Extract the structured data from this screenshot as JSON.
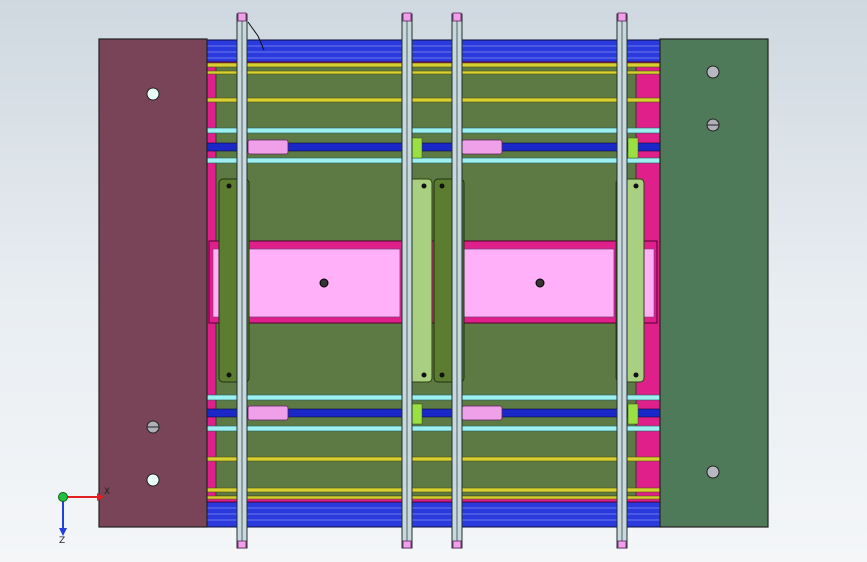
{
  "view": {
    "background_top": "#cfd8e0",
    "background_bottom": "#f4f6f8"
  },
  "triad": {
    "x_label": "X",
    "z_label": "Z",
    "x_color": "#e02020",
    "y_color": "#20c040",
    "z_color": "#2040e0"
  },
  "parts": [
    {
      "name": "left-clamp-plate",
      "color": "#7a4458"
    },
    {
      "name": "right-clamp-plate",
      "color": "#4f7a5a"
    },
    {
      "name": "base-plate",
      "color": "#5e7a44"
    },
    {
      "name": "blue-plate",
      "color": "#2a3adc"
    },
    {
      "name": "yellow-guide-rails",
      "color": "#d8d030"
    },
    {
      "name": "cyan-rods",
      "color": "#9ef0f0"
    },
    {
      "name": "magenta-frame",
      "color": "#e0208a"
    },
    {
      "name": "pink-insert",
      "color": "#ffb0f8"
    },
    {
      "name": "light-green-side-blocks",
      "color": "#a8d080"
    },
    {
      "name": "dark-green-side-blocks",
      "color": "#5c7d30"
    },
    {
      "name": "pink-slider",
      "color": "#f0a0e8"
    }
  ]
}
